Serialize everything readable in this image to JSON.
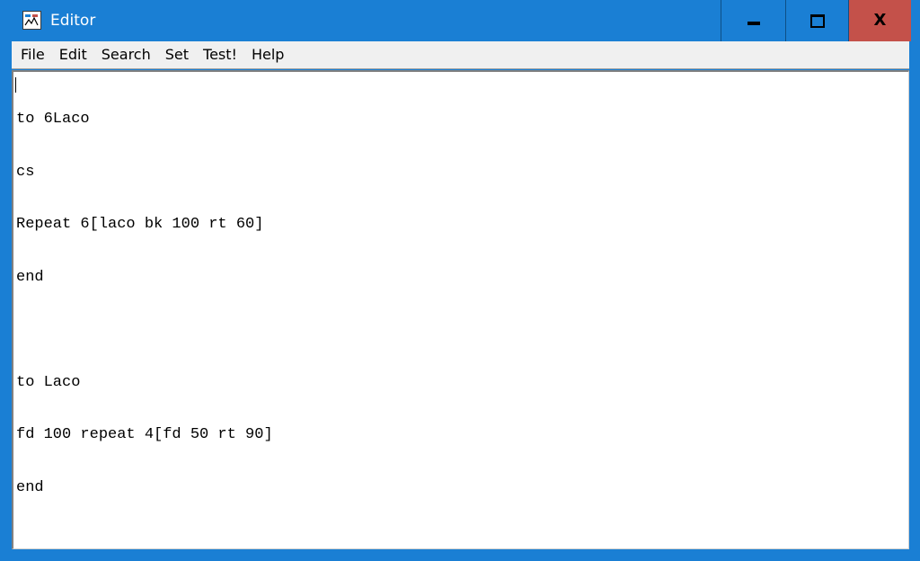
{
  "window": {
    "title": "Editor",
    "icon": "logo-editor-icon",
    "controls": {
      "minimize": "minimize-icon",
      "maximize": "maximize-icon",
      "close": "X"
    },
    "colors": {
      "titlebar": "#1a7fd4",
      "close_button": "#c4514a",
      "menubar": "#f0f0f0",
      "editor_bg": "#ffffff"
    }
  },
  "menu": {
    "items": [
      "File",
      "Edit",
      "Search",
      "Set",
      "Test!",
      "Help"
    ]
  },
  "editor": {
    "lines": [
      "to 6Laco",
      "cs",
      "Repeat 6[laco bk 100 rt 60]",
      "end",
      "",
      "to Laco",
      "fd 100 repeat 4[fd 50 rt 90]",
      "end"
    ]
  }
}
